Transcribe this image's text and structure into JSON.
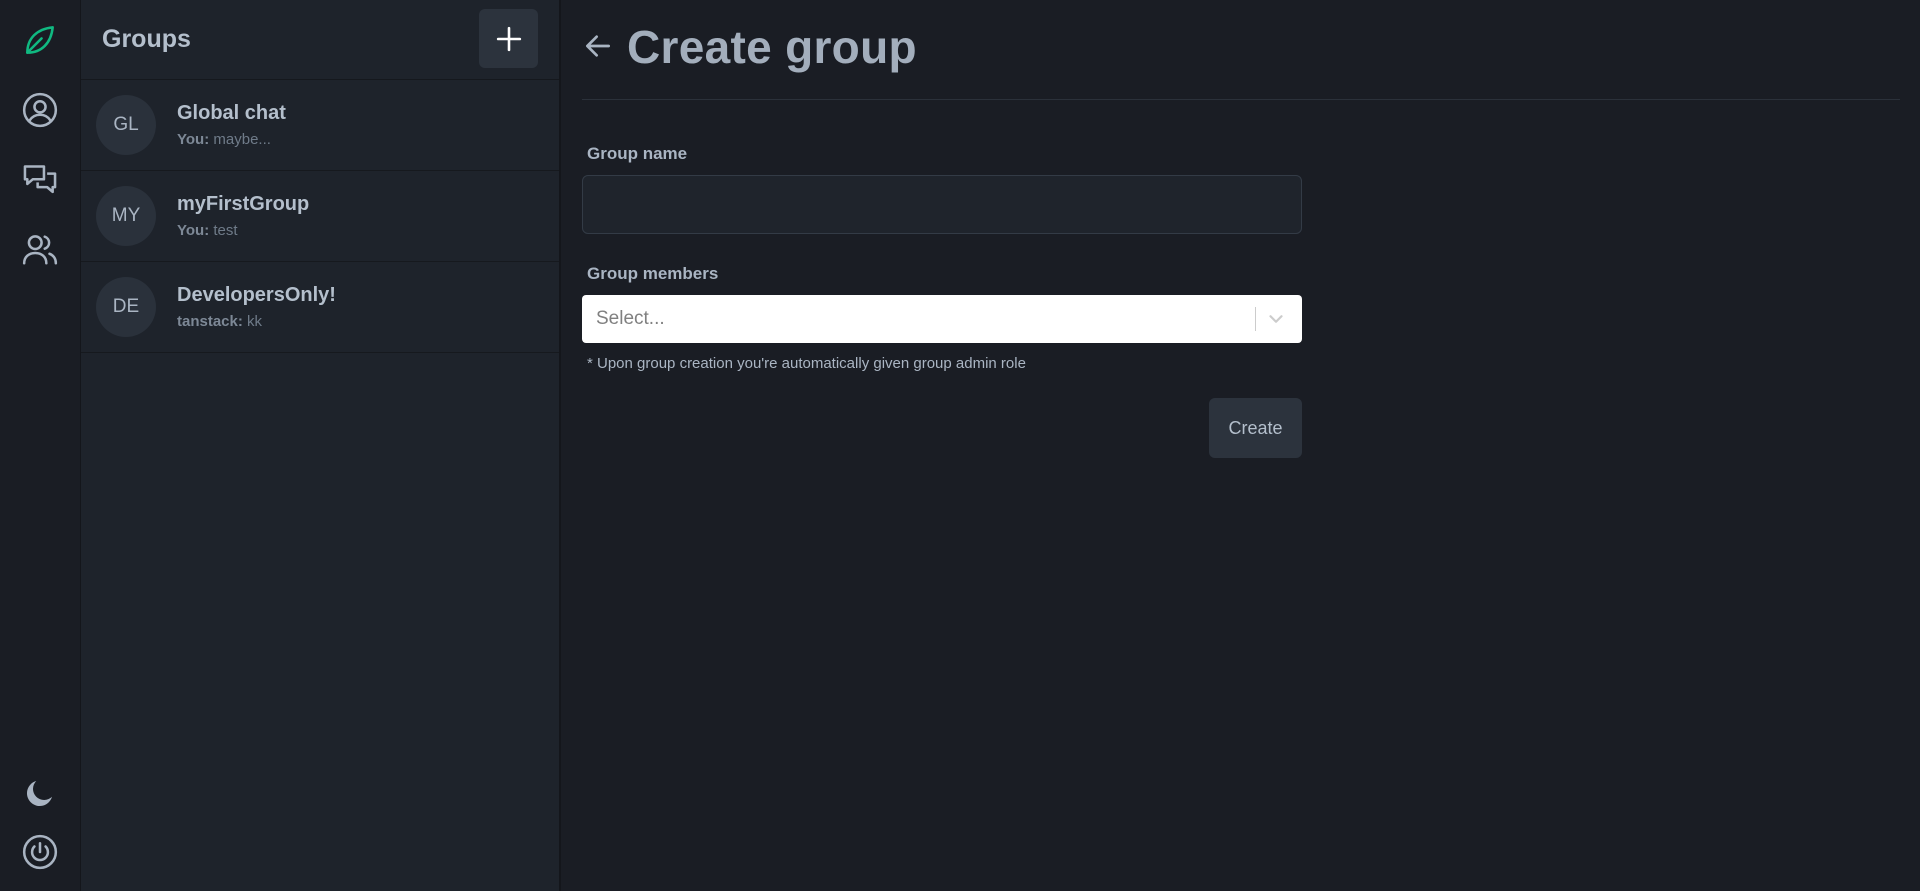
{
  "colors": {
    "accent": "#10b981",
    "background": "#1a1d24",
    "panel": "#1e232b",
    "button": "#2c333d"
  },
  "rail": {
    "icons": [
      "leaf-logo-icon",
      "user-circle-icon",
      "chat-bubbles-icon",
      "users-icon",
      "moon-icon",
      "power-icon"
    ]
  },
  "groups": {
    "title": "Groups",
    "add_icon": "plus-icon",
    "items": [
      {
        "initials": "GL",
        "name": "Global chat",
        "sender": "You:",
        "message": "maybe..."
      },
      {
        "initials": "MY",
        "name": "myFirstGroup",
        "sender": "You:",
        "message": "test"
      },
      {
        "initials": "DE",
        "name": "DevelopersOnly!",
        "sender": "tanstack:",
        "message": "kk"
      }
    ]
  },
  "main": {
    "title": "Create group",
    "group_name_label": "Group name",
    "group_name_value": "",
    "group_members_label": "Group members",
    "members_placeholder": "Select...",
    "hint": "* Upon group creation you're automatically given group admin role",
    "create_label": "Create"
  }
}
